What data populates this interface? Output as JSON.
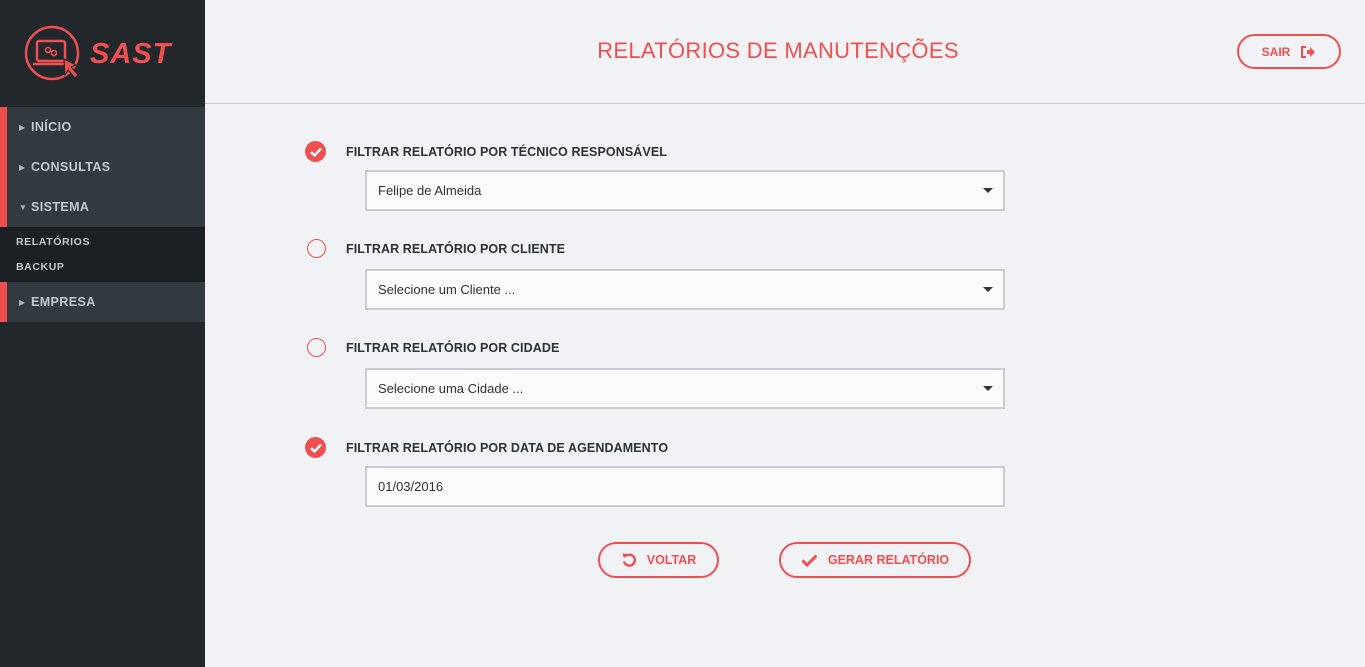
{
  "brand": {
    "name": "SAST",
    "accent_color": "#ef4f4f",
    "sidebar_color": "#22282c"
  },
  "sidebar": {
    "items": [
      {
        "label": "INÍCIO",
        "icon": "caret-right-icon"
      },
      {
        "label": "CONSULTAS",
        "icon": "caret-right-icon"
      },
      {
        "label": "SISTEMA",
        "icon": "caret-down-icon",
        "expanded": true,
        "subitems": [
          {
            "label": "RELATÓRIOS"
          },
          {
            "label": "BACKUP"
          }
        ]
      },
      {
        "label": "EMPRESA",
        "icon": "caret-right-icon"
      }
    ]
  },
  "header": {
    "title": "RELATÓRIOS DE MANUTENÇÕES",
    "logout_label": "SAIR",
    "logout_icon": "sign-out-icon"
  },
  "filters": [
    {
      "label": "FILTRAR RELATÓRIO POR TÉCNICO RESPONSÁVEL",
      "checked": true,
      "type": "select",
      "value": "Felipe de Almeida"
    },
    {
      "label": "FILTRAR RELATÓRIO POR CLIENTE",
      "checked": false,
      "type": "select",
      "value": "Selecione um Cliente ..."
    },
    {
      "label": "FILTRAR RELATÓRIO POR CIDADE",
      "checked": false,
      "type": "select",
      "value": "Selecione uma Cidade ..."
    },
    {
      "label": "FILTRAR RELATÓRIO POR DATA DE AGENDAMENTO",
      "checked": true,
      "type": "input",
      "value": "01/03/2016"
    }
  ],
  "actions": {
    "back_label": "VOLTAR",
    "back_icon": "undo-icon",
    "generate_label": "GERAR RELATÓRIO",
    "generate_icon": "check-icon"
  }
}
